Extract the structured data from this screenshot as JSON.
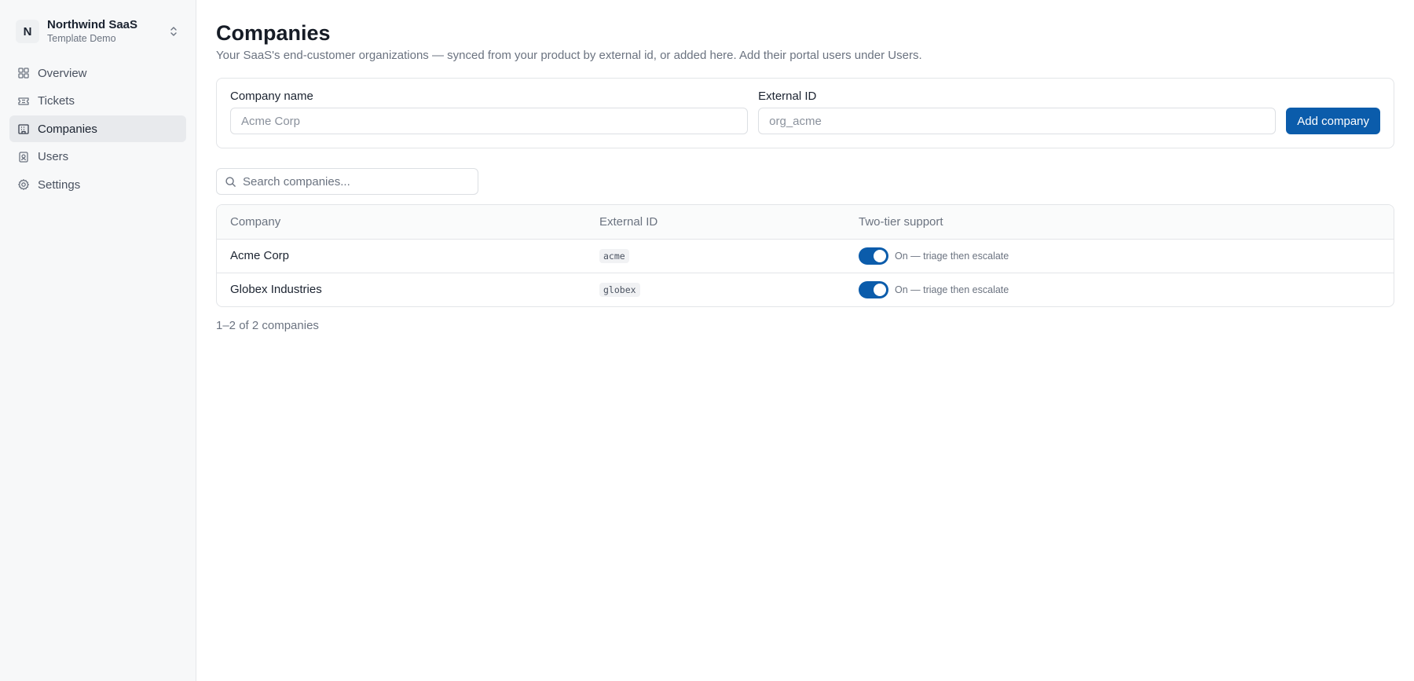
{
  "org": {
    "initial": "N",
    "name": "Northwind SaaS",
    "subtitle": "Template Demo"
  },
  "nav": [
    {
      "label": "Overview",
      "icon": "grid-icon",
      "active": false
    },
    {
      "label": "Tickets",
      "icon": "ticket-icon",
      "active": false
    },
    {
      "label": "Companies",
      "icon": "building-icon",
      "active": true
    },
    {
      "label": "Users",
      "icon": "user-badge-icon",
      "active": false
    },
    {
      "label": "Settings",
      "icon": "gear-icon",
      "active": false
    }
  ],
  "page": {
    "title": "Companies",
    "description": "Your SaaS's end-customer organizations — synced from your product by external id, or added here. Add their portal users under Users."
  },
  "form": {
    "name_label": "Company name",
    "name_placeholder": "Acme Corp",
    "extid_label": "External ID",
    "extid_placeholder": "org_acme",
    "submit_label": "Add company"
  },
  "search": {
    "placeholder": "Search companies..."
  },
  "table": {
    "columns": [
      "Company",
      "External ID",
      "Two-tier support"
    ],
    "rows": [
      {
        "company": "Acme Corp",
        "external_id": "acme",
        "two_tier": true,
        "two_tier_label": "On — triage then escalate"
      },
      {
        "company": "Globex Industries",
        "external_id": "globex",
        "two_tier": true,
        "two_tier_label": "On — triage then escalate"
      }
    ]
  },
  "pager": {
    "summary": "1–2 of 2 companies"
  },
  "colors": {
    "accent": "#0b5cab",
    "sidebar_bg": "#f7f8f9"
  }
}
